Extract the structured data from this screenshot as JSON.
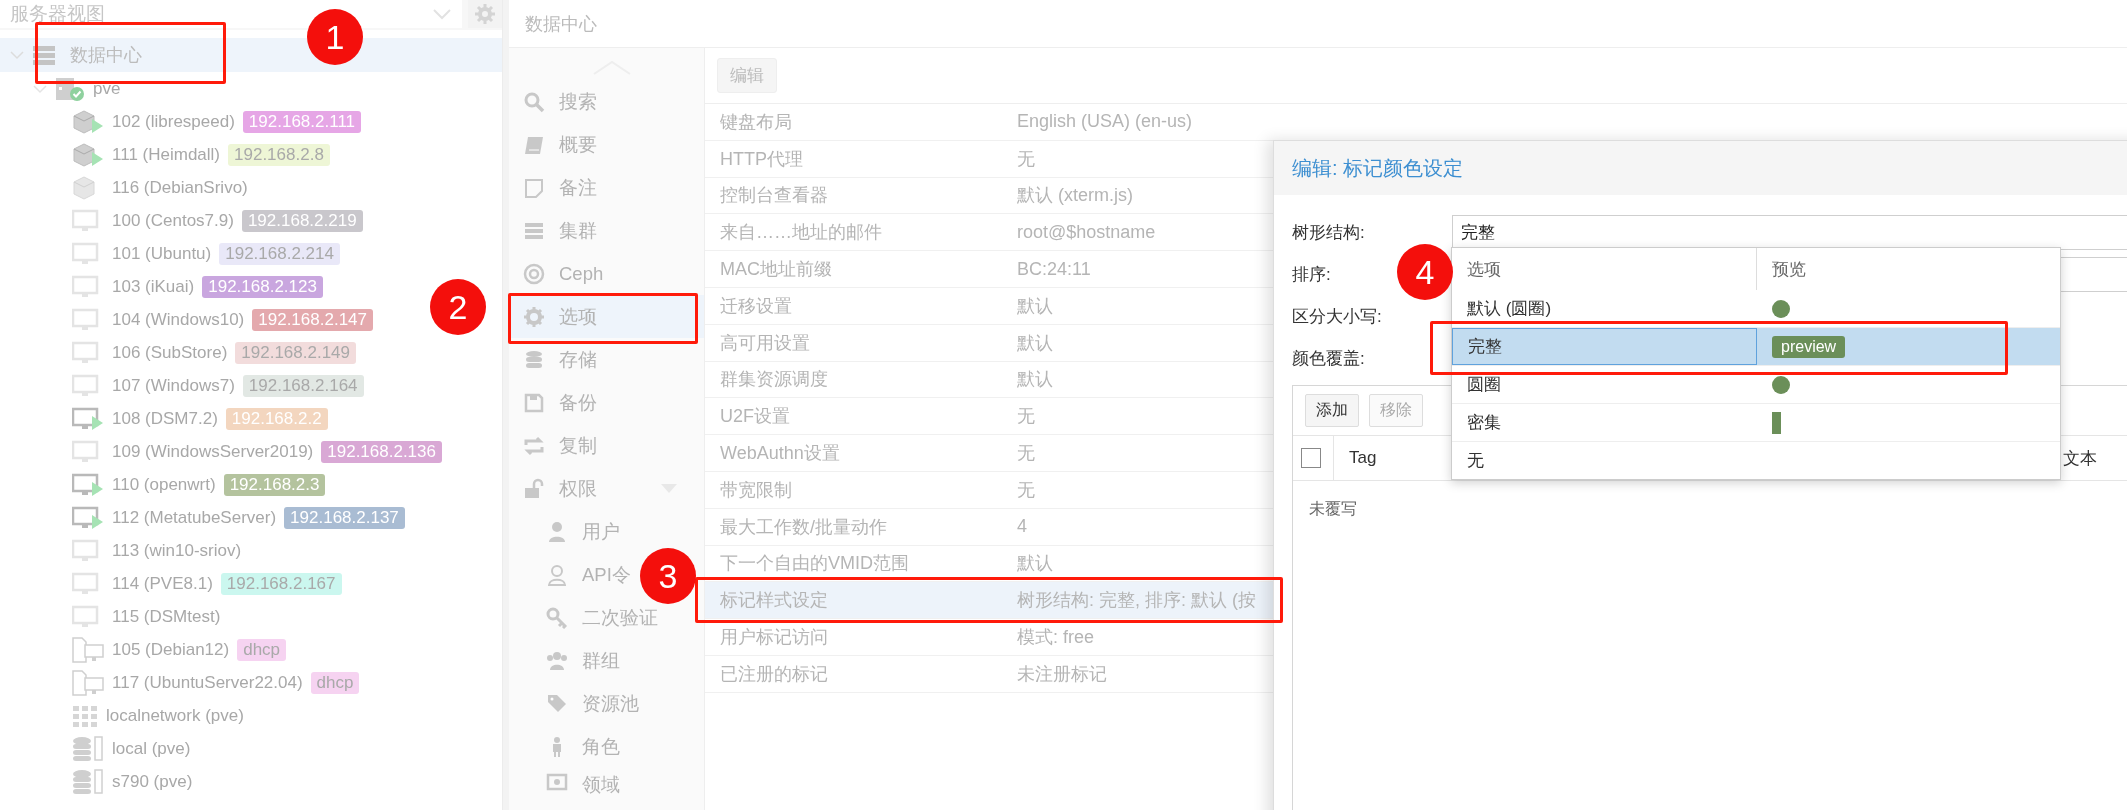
{
  "server_view": {
    "placeholder": "服务器视图"
  },
  "tree": [
    {
      "label": "数据中心",
      "kind": "datacenter",
      "selected": true,
      "expanded": true,
      "children": [
        {
          "label": "pve",
          "kind": "node",
          "selected": false,
          "expanded": true,
          "children": [
            {
              "label": "102 (librespeed)",
              "kind": "container",
              "running": true,
              "selected": false,
              "tags": [
                {
                  "label": "192.168.2.111",
                  "color": "#e6a6e6",
                  "light_text": true
                }
              ]
            },
            {
              "label": "111 (Heimdall)",
              "kind": "container",
              "running": true,
              "selected": false,
              "tags": [
                {
                  "label": "192.168.2.8",
                  "color": "#eef6d6",
                  "light_text": false
                }
              ]
            },
            {
              "label": "116 (DebianSrivo)",
              "kind": "container",
              "running": false,
              "selected": false
            },
            {
              "label": "100 (Centos7.9)",
              "kind": "vm",
              "running": false,
              "selected": false,
              "tags": [
                {
                  "label": "192.168.2.219",
                  "color": "#c9c7cc",
                  "light_text": true
                }
              ]
            },
            {
              "label": "101 (Ubuntu)",
              "kind": "vm",
              "running": false,
              "selected": false,
              "tags": [
                {
                  "label": "192.168.2.214",
                  "color": "#e9e8f8",
                  "light_text": false
                }
              ]
            },
            {
              "label": "103 (iKuai)",
              "kind": "vm",
              "running": false,
              "selected": false,
              "tags": [
                {
                  "label": "192.168.2.123",
                  "color": "#c9a6df",
                  "light_text": true
                }
              ]
            },
            {
              "label": "104 (Windows10)",
              "kind": "vm",
              "running": false,
              "selected": false,
              "tags": [
                {
                  "label": "192.168.2.147",
                  "color": "#e4a9ad",
                  "light_text": true
                }
              ]
            },
            {
              "label": "106 (SubStore)",
              "kind": "vm",
              "running": false,
              "selected": false,
              "tags": [
                {
                  "label": "192.168.2.149",
                  "color": "#f2dcdc",
                  "light_text": false
                }
              ]
            },
            {
              "label": "107 (Windows7)",
              "kind": "vm",
              "running": false,
              "selected": false,
              "tags": [
                {
                  "label": "192.168.2.164",
                  "color": "#e2e8e4",
                  "light_text": false
                }
              ]
            },
            {
              "label": "108 (DSM7.2)",
              "kind": "vm",
              "running": true,
              "selected": false,
              "tags": [
                {
                  "label": "192.168.2.2",
                  "color": "#f3d6bf",
                  "light_text": true
                }
              ]
            },
            {
              "label": "109 (WindowsServer2019)",
              "kind": "vm",
              "running": false,
              "selected": false,
              "tags": [
                {
                  "label": "192.168.2.136",
                  "color": "#d9a8d5",
                  "light_text": true
                }
              ]
            },
            {
              "label": "110 (openwrt)",
              "kind": "vm",
              "running": true,
              "selected": false,
              "tags": [
                {
                  "label": "192.168.2.3",
                  "color": "#b4c39e",
                  "light_text": true
                }
              ]
            },
            {
              "label": "112 (MetatubeServer)",
              "kind": "vm",
              "running": true,
              "selected": false,
              "tags": [
                {
                  "label": "192.168.2.137",
                  "color": "#a9bcd3",
                  "light_text": true
                }
              ]
            },
            {
              "label": "113 (win10-sriov)",
              "kind": "vm",
              "running": false,
              "selected": false
            },
            {
              "label": "114 (PVE8.1)",
              "kind": "vm",
              "running": false,
              "selected": false,
              "tags": [
                {
                  "label": "192.168.2.167",
                  "color": "#cbf7ef",
                  "light_text": false
                }
              ]
            },
            {
              "label": "115 (DSMtest)",
              "kind": "vm",
              "running": false,
              "selected": false
            },
            {
              "label": "105 (Debian12)",
              "kind": "template",
              "selected": false,
              "tags": [
                {
                  "label": "dhcp",
                  "color": "#f6d3f1",
                  "light_text": false
                }
              ]
            },
            {
              "label": "117 (UbuntuServer22.04)",
              "kind": "template",
              "selected": false,
              "tags": [
                {
                  "label": "dhcp",
                  "color": "#f6d3f1",
                  "light_text": false
                }
              ]
            },
            {
              "label": "localnetwork (pve)",
              "kind": "sdn",
              "selected": false
            },
            {
              "label": "local (pve)",
              "kind": "storage",
              "selected": false
            },
            {
              "label": "s790 (pve)",
              "kind": "storage",
              "selected": false
            }
          ]
        }
      ]
    }
  ],
  "header": {
    "title": "数据中心"
  },
  "nav": [
    {
      "label": "搜索",
      "selected": false
    },
    {
      "label": "概要",
      "selected": false
    },
    {
      "label": "备注",
      "selected": false
    },
    {
      "label": "集群",
      "selected": false
    },
    {
      "label": "Ceph",
      "selected": false
    },
    {
      "label": "选项",
      "selected": true
    },
    {
      "label": "存储",
      "selected": false
    },
    {
      "label": "备份",
      "selected": false
    },
    {
      "label": "复制",
      "selected": false
    },
    {
      "label": "权限",
      "selected": false,
      "expanded": true,
      "children": [
        {
          "label": "用户",
          "selected": false
        },
        {
          "label": "API令",
          "selected": false
        },
        {
          "label": "二次验证",
          "selected": false
        },
        {
          "label": "群组",
          "selected": false
        },
        {
          "label": "资源池",
          "selected": false
        },
        {
          "label": "角色",
          "selected": false
        },
        {
          "label": "领域",
          "selected": false
        }
      ]
    }
  ],
  "toolbar": {
    "edit_button": "编辑"
  },
  "options": [
    {
      "key": "键盘布局",
      "value": "English (USA) (en-us)",
      "selected": false
    },
    {
      "key": "HTTP代理",
      "value": "无",
      "selected": false
    },
    {
      "key": "控制台查看器",
      "value": "默认 (xterm.js)",
      "selected": false
    },
    {
      "key": "来自……地址的邮件",
      "value": "root@$hostname",
      "selected": false
    },
    {
      "key": "MAC地址前缀",
      "value": "BC:24:11",
      "selected": false
    },
    {
      "key": "迁移设置",
      "value": "默认",
      "selected": false
    },
    {
      "key": "高可用设置",
      "value": "默认",
      "selected": false
    },
    {
      "key": "群集资源调度",
      "value": "默认",
      "selected": false
    },
    {
      "key": "U2F设置",
      "value": "无",
      "selected": false
    },
    {
      "key": "WebAuthn设置",
      "value": "无",
      "selected": false
    },
    {
      "key": "带宽限制",
      "value": "无",
      "selected": false
    },
    {
      "key": "最大工作数/批量动作",
      "value": "4",
      "selected": false
    },
    {
      "key": "下一个自由的VMID范围",
      "value": "默认",
      "selected": false
    },
    {
      "key": "标记样式设定",
      "value": "树形结构: 完整, 排序: 默认 (按",
      "selected": true
    },
    {
      "key": "用户标记访问",
      "value": "模式: free",
      "selected": false
    },
    {
      "key": "已注册的标记",
      "value": "未注册标记",
      "selected": false
    }
  ],
  "dialog": {
    "title": "编辑: 标记颜色设定",
    "fields": [
      {
        "label": "树形结构:",
        "kind": "combo",
        "value": "完整"
      },
      {
        "label": "排序:",
        "kind": "combo"
      },
      {
        "label": "区分大小写:",
        "kind": "label"
      },
      {
        "label": "颜色覆盖:",
        "kind": "label"
      }
    ],
    "grid": {
      "buttons": [
        {
          "label": "添加",
          "disabled": false
        },
        {
          "label": "移除",
          "disabled": true
        }
      ],
      "select_all_checked": false,
      "columns": [
        "Tag",
        "文本"
      ],
      "empty_text": "未覆写"
    },
    "dropdown": {
      "columns": [
        "选项",
        "预览"
      ],
      "options": [
        {
          "label": "默认 (圆圈)",
          "kind": "circle",
          "selected": false
        },
        {
          "label": "完整",
          "kind": "full",
          "preview": "preview",
          "selected": true
        },
        {
          "label": "圆圈",
          "kind": "circle",
          "selected": false
        },
        {
          "label": "密集",
          "kind": "dense",
          "selected": false
        },
        {
          "label": "无",
          "kind": "none",
          "selected": false
        }
      ]
    }
  },
  "annotations": [
    {
      "number": "1"
    },
    {
      "number": "2"
    },
    {
      "number": "3"
    },
    {
      "number": "4"
    }
  ]
}
